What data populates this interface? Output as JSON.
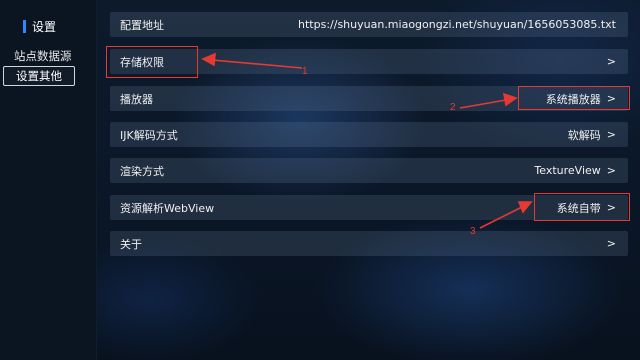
{
  "sidebar": {
    "title": "设置",
    "items": [
      {
        "label": "站点数据源"
      },
      {
        "label": "设置其他"
      }
    ]
  },
  "settings": [
    {
      "label": "配置地址",
      "value": "https://shuyuan.miaogongzi.net/shuyuan/1656053085.txt",
      "arrow": ">"
    },
    {
      "label": "存储权限",
      "value": "",
      "arrow": ">"
    },
    {
      "label": "播放器",
      "value": "系统播放器",
      "arrow": ">"
    },
    {
      "label": "IJK解码方式",
      "value": "软解码",
      "arrow": ">"
    },
    {
      "label": "渲染方式",
      "value": "TextureView",
      "arrow": ">"
    },
    {
      "label": "资源解析WebView",
      "value": "系统自带",
      "arrow": ">"
    },
    {
      "label": "关于",
      "value": "",
      "arrow": ">"
    }
  ],
  "annotations": {
    "color": "#e53a34",
    "numbers": [
      "1",
      "2",
      "3"
    ]
  },
  "colors": {
    "accent": "#2f86ff",
    "row_bg": "rgba(110,130,160,0.22)",
    "annotation": "#e53a34"
  }
}
